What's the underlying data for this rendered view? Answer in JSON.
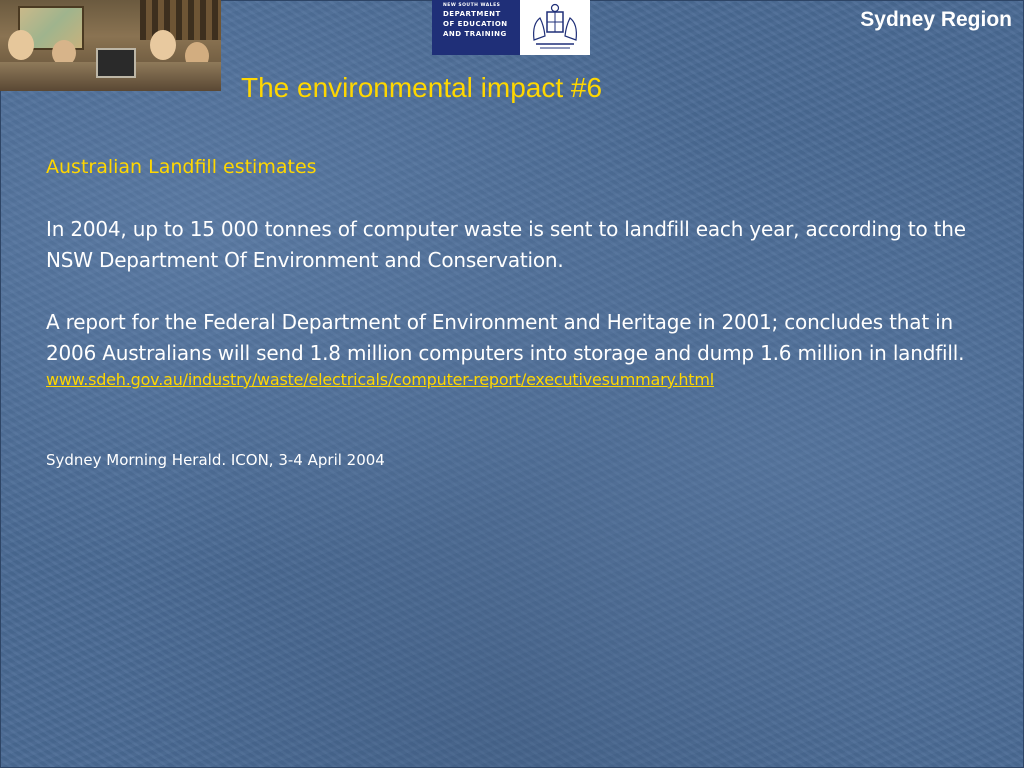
{
  "header": {
    "region": "Sydney Region",
    "title": "The environmental impact #6"
  },
  "logo": {
    "lines": [
      "NEW SOUTH WALES",
      "DEPARTMENT",
      "OF EDUCATION",
      "AND TRAINING"
    ]
  },
  "content": {
    "subheading": "Australian Landfill estimates",
    "paragraph1": "In 2004, up to 15 000 tonnes of computer waste is sent to landfill each year, according to the NSW Department Of Environment and Conservation.",
    "paragraph2": "A report for the Federal Department of Environment and Heritage in 2001; concludes that in 2006 Australians will send 1.8 million computers into storage and dump 1.6 million in landfill.",
    "link": "www.sdeh.gov.au/industry/waste/electricals/computer-report/executivesummary.html",
    "citation": "Sydney Morning Herald. ICON, 3-4 April 2004"
  },
  "colors": {
    "background": "#4a6a94",
    "heading_accent": "#ffd700",
    "body_text": "#ffffff",
    "logo_navy": "#1f2f78"
  }
}
